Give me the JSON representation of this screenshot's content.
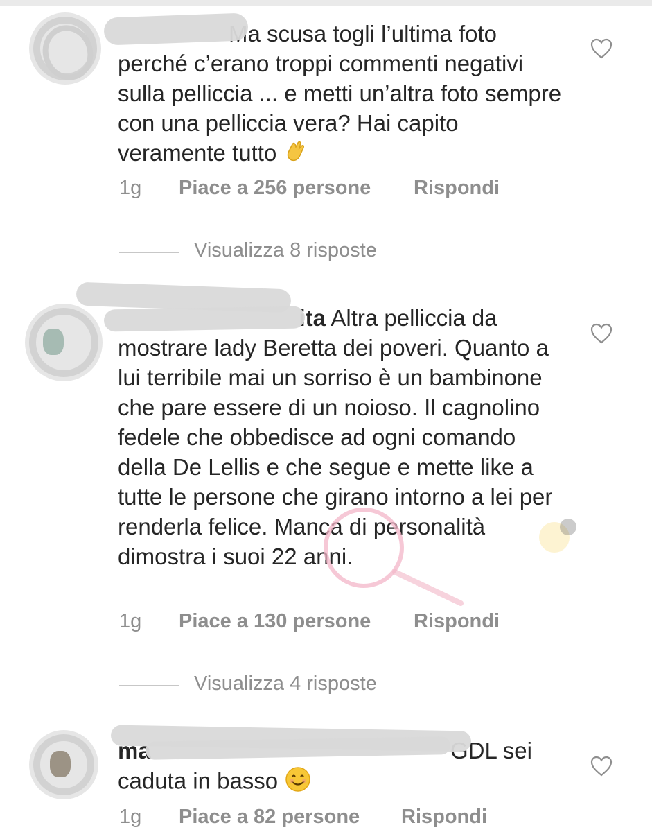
{
  "comments": [
    {
      "username": "",
      "text": "Ma scusa togli l’ultima foto perché c’erano troppi commenti negativi sulla pelliccia ... e metti un’altra foto sempre con una pelliccia vera? Hai capito veramente tutto",
      "emoji": "clapping-hands",
      "time": "1g",
      "likes": "Piace a 256 persone",
      "reply": "Rispondi",
      "view_replies": "Visualizza 8 risposte"
    },
    {
      "username": "ita",
      "text": "Altra pelliccia da mostrare lady Beretta dei poveri. Quanto a lui  terribile mai un sorriso è un bambinone  che pare essere di un noioso. Il cagnolino fedele che obbedisce ad ogni comando della De Lellis e che segue e mette like a tutte le persone che girano intorno a lei per renderla felice. Manca di personalità dimostra i suoi 22 anni.",
      "time": "1g",
      "likes": "Piace a 130 persone",
      "reply": "Rispondi",
      "view_replies": "Visualizza 4 risposte"
    },
    {
      "username": "ma",
      "text": "GDL sei caduta in basso",
      "emoji": "smiling-face",
      "time": "1g",
      "likes": "Piace a 82 persone",
      "reply": "Rispondi"
    }
  ],
  "icons": {
    "like": "heart-outline-icon"
  },
  "colors": {
    "text": "#262626",
    "secondary": "#8e8e8e",
    "redaction": "#d9d9d9"
  }
}
